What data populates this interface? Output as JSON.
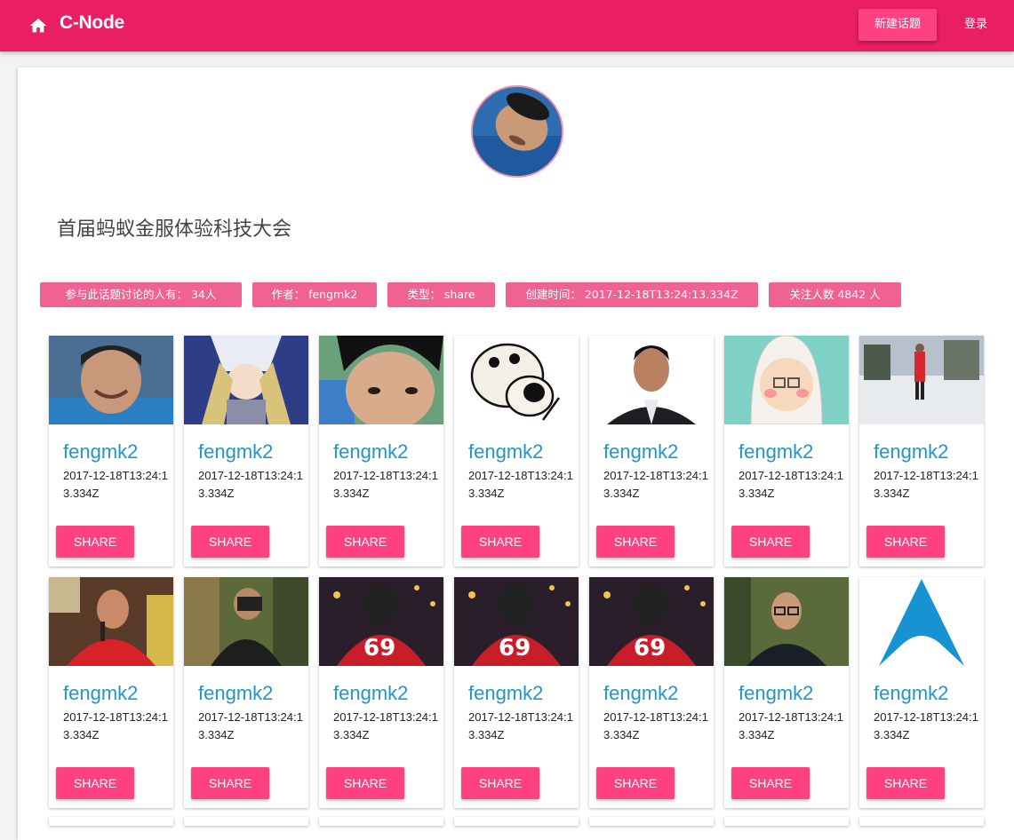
{
  "app": {
    "title": "C-Node",
    "new_topic_label": "新建话题",
    "login_label": "登录",
    "accent": "#e91e63",
    "button_color": "#ff4081"
  },
  "topic": {
    "title": "首届蚂蚁金服体验科技大会",
    "chips": [
      {
        "text": "参与此话题讨论的人有： 34人"
      },
      {
        "text": "作者： fengmk2"
      },
      {
        "text": "类型： share"
      },
      {
        "text": "创建时间： 2017-12-18T13:24:13.334Z"
      },
      {
        "text": "关注人数 4842 人"
      }
    ]
  },
  "users": [
    {
      "name": "fengmk2",
      "date": "2017-12-18T13:24:13.334Z",
      "share_label": "SHARE",
      "picture": "man-laughing-photo"
    },
    {
      "name": "fengmk2",
      "date": "2017-12-18T13:24:13.334Z",
      "share_label": "SHARE",
      "picture": "anime-character-illustration"
    },
    {
      "name": "fengmk2",
      "date": "2017-12-18T13:24:13.334Z",
      "share_label": "SHARE",
      "picture": "selfie-photo"
    },
    {
      "name": "fengmk2",
      "date": "2017-12-18T13:24:13.334Z",
      "share_label": "SHARE",
      "picture": "cartoon-dog-illustration"
    },
    {
      "name": "fengmk2",
      "date": "2017-12-18T13:24:13.334Z",
      "share_label": "SHARE",
      "picture": "man-in-suit-photo"
    },
    {
      "name": "fengmk2",
      "date": "2017-12-18T13:24:13.334Z",
      "share_label": "SHARE",
      "picture": "cartoon-girl-illustration"
    },
    {
      "name": "fengmk2",
      "date": "2017-12-18T13:24:13.334Z",
      "share_label": "SHARE",
      "picture": "snow-park-photo"
    },
    {
      "name": "fengmk2",
      "date": "2017-12-18T13:24:13.334Z",
      "share_label": "SHARE",
      "picture": "man-speaking-photo"
    },
    {
      "name": "fengmk2",
      "date": "2017-12-18T13:24:13.334Z",
      "share_label": "SHARE",
      "picture": "photographer-in-forest-photo"
    },
    {
      "name": "fengmk2",
      "date": "2017-12-18T13:24:13.334Z",
      "share_label": "SHARE",
      "picture": "jersey-69-photo"
    },
    {
      "name": "fengmk2",
      "date": "2017-12-18T13:24:13.334Z",
      "share_label": "SHARE",
      "picture": "jersey-69-photo"
    },
    {
      "name": "fengmk2",
      "date": "2017-12-18T13:24:13.334Z",
      "share_label": "SHARE",
      "picture": "jersey-69-photo"
    },
    {
      "name": "fengmk2",
      "date": "2017-12-18T13:24:13.334Z",
      "share_label": "SHARE",
      "picture": "man-with-glasses-photo"
    },
    {
      "name": "fengmk2",
      "date": "2017-12-18T13:24:13.334Z",
      "share_label": "SHARE",
      "picture": "arch-logo"
    }
  ]
}
